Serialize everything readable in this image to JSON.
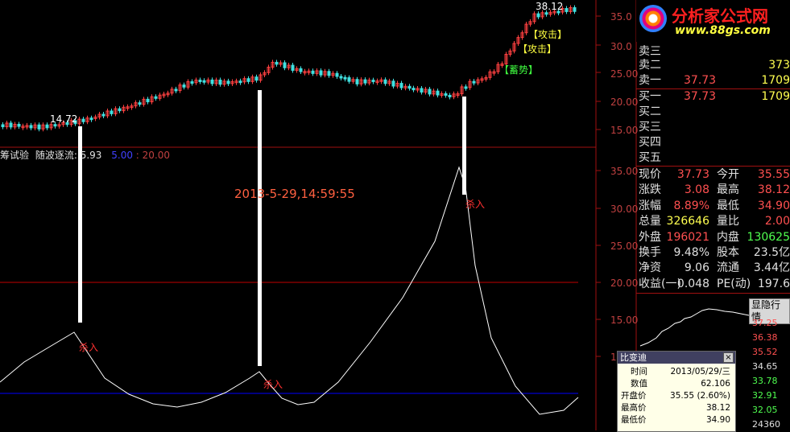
{
  "brand": {
    "name": "分析家公式网",
    "url": "www.88gs.com"
  },
  "top_chart": {
    "price_low_label": "14.72",
    "price_high_label": "38.12",
    "signals": [
      "【攻击】",
      "【攻击】",
      "【蓄势】"
    ],
    "y_ticks": [
      "35.0",
      "30.0",
      "25.00",
      "20.00",
      "15.00"
    ]
  },
  "indicator": {
    "title": "筹试验",
    "params": "随波逐流: 5.93",
    "level_low": "5.00",
    "level_high": "20.00",
    "date_label": "2013-5-29,14:59:55",
    "buy_signal_label": "杀入",
    "y_ticks": [
      "35.00",
      "30.00",
      "25.00",
      "20.00",
      "15.00",
      "1"
    ]
  },
  "order_book": {
    "asks": [
      {
        "label": "卖三",
        "price": "",
        "volume": ""
      },
      {
        "label": "卖二",
        "price": "",
        "volume": "373"
      },
      {
        "label": "卖一",
        "price": "37.73",
        "volume": "1709"
      }
    ],
    "bids": [
      {
        "label": "买一",
        "price": "37.73",
        "volume": "1709"
      },
      {
        "label": "买二",
        "price": "",
        "volume": ""
      },
      {
        "label": "买三",
        "price": "",
        "volume": ""
      },
      {
        "label": "买四",
        "price": "",
        "volume": ""
      },
      {
        "label": "买五",
        "price": "",
        "volume": ""
      }
    ]
  },
  "quote": [
    {
      "l1": "现价",
      "v1": "37.73",
      "c1": "#ff5050",
      "l2": "今开",
      "v2": "35.55",
      "c2": "#ff5050"
    },
    {
      "l1": "涨跌",
      "v1": "3.08",
      "c1": "#ff5050",
      "l2": "最高",
      "v2": "38.12",
      "c2": "#ff5050"
    },
    {
      "l1": "涨幅",
      "v1": "8.89%",
      "c1": "#ff5050",
      "l2": "最低",
      "v2": "34.90",
      "c2": "#ff5050"
    },
    {
      "l1": "总量",
      "v1": "326646",
      "c1": "#ffff50",
      "l2": "量比",
      "v2": "2.00",
      "c2": "#ff5050"
    },
    {
      "l1": "外盘",
      "v1": "196021",
      "c1": "#ff5050",
      "l2": "内盘",
      "v2": "130625",
      "c2": "#50ff50"
    },
    {
      "l1": "换手",
      "v1": "9.48%",
      "c1": "#e0e0e0",
      "l2": "股本",
      "v2": "23.5亿",
      "c2": "#e0e0e0"
    },
    {
      "l1": "净资",
      "v1": "9.06",
      "c1": "#e0e0e0",
      "l2": "流通",
      "v2": "3.44亿",
      "c2": "#e0e0e0"
    },
    {
      "l1": "收益(一)",
      "v1": "0.048",
      "c1": "#e0e0e0",
      "l2": "PE(动)",
      "v2": "197.6",
      "c2": "#e0e0e0"
    }
  ],
  "mini_chart": {
    "toggle_label": "显隐行情",
    "y_ticks": [
      {
        "v": "37.25",
        "c": "#ff5050"
      },
      {
        "v": "36.38",
        "c": "#ff5050"
      },
      {
        "v": "35.52",
        "c": "#ff5050"
      },
      {
        "v": "34.65",
        "c": "#e0e0e0"
      },
      {
        "v": "33.78",
        "c": "#50ff50"
      },
      {
        "v": "32.91",
        "c": "#50ff50"
      },
      {
        "v": "32.05",
        "c": "#50ff50"
      },
      {
        "v": "24360",
        "c": "#e0e0e0"
      }
    ]
  },
  "popup": {
    "title": "比变迪",
    "rows": [
      {
        "k": "时间",
        "v": "2013/05/29/三"
      },
      {
        "k": "数值",
        "v": "62.106"
      },
      {
        "k": "开盘价",
        "v": "35.55 (2.60%)"
      },
      {
        "k": "最高价",
        "v": "38.12"
      },
      {
        "k": "最低价",
        "v": "34.90"
      }
    ]
  },
  "colors": {
    "grid_red": "#a01010",
    "up": "#ff4040",
    "down": "#40e0e0",
    "signal_yellow": "#ffff40",
    "signal_green": "#40ff40",
    "blue_level": "#0000ff"
  }
}
